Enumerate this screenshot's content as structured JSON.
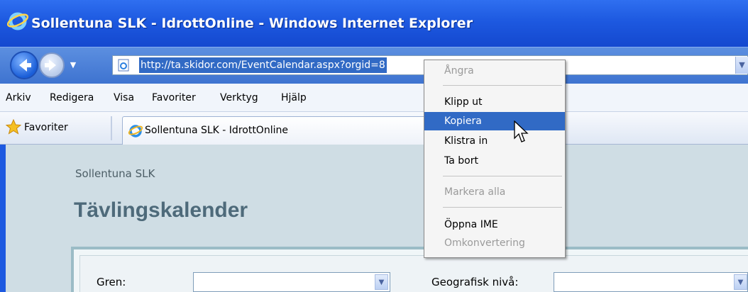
{
  "window": {
    "title": "Sollentuna SLK - IdrottOnline - Windows Internet Explorer"
  },
  "address_bar": {
    "url": "http://ta.skidor.com/EventCalendar.aspx?orgid=8"
  },
  "menu": {
    "items": [
      "Arkiv",
      "Redigera",
      "Visa",
      "Favoriter",
      "Verktyg",
      "Hjälp"
    ]
  },
  "favorites_bar": {
    "favorites_label": "Favoriter",
    "tab_label": "Sollentuna SLK - IdrottOnline"
  },
  "page": {
    "club_name": "Sollentuna SLK",
    "title": "Tävlingskalender",
    "form": {
      "gren_label": "Gren:",
      "geo_label": "Geografisk nivå:"
    }
  },
  "context_menu": {
    "items": [
      {
        "label": "Ångra",
        "enabled": false
      },
      {
        "label": "Klipp ut",
        "enabled": true
      },
      {
        "label": "Kopiera",
        "enabled": true,
        "highlighted": true
      },
      {
        "label": "Klistra in",
        "enabled": true
      },
      {
        "label": "Ta bort",
        "enabled": true
      },
      {
        "label": "Markera alla",
        "enabled": false
      },
      {
        "label": "Öppna IME",
        "enabled": true
      },
      {
        "label": "Omkonvertering",
        "enabled": false
      }
    ]
  },
  "colors": {
    "titlebar": "#1d59e0",
    "selection": "#316ac5",
    "page_background": "#cfdde4",
    "page_title": "#4e6a7a"
  },
  "icons": [
    "ie-logo-icon",
    "back-arrow-icon",
    "forward-arrow-icon",
    "page-icon",
    "star-icon",
    "dropdown-arrow-icon",
    "mouse-pointer-icon"
  ]
}
